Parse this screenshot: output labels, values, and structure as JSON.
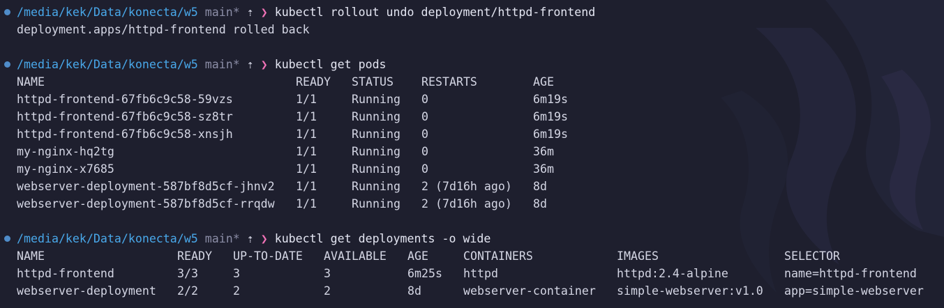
{
  "theme": {
    "background": "#1e1f2e",
    "path_color": "#49a8ea",
    "branch_color": "#8b8da6",
    "prompt_symbol_color": "#f072b6",
    "text_color": "#d4d6e4",
    "bullet_color": "#4f8cc9"
  },
  "prompt": {
    "path": "/media/kek/Data/konecta/w5",
    "branch": "main*",
    "ahead_icon": "⇡",
    "symbol": "❯"
  },
  "blocks": [
    {
      "command": "kubectl rollout undo deployment/httpd-frontend",
      "output": "deployment.apps/httpd-frontend rolled back"
    },
    {
      "command": "kubectl get pods",
      "headers": [
        "NAME",
        "READY",
        "STATUS",
        "RESTARTS",
        "AGE"
      ],
      "rows": [
        [
          "httpd-frontend-67fb6c9c58-59vzs",
          "1/1",
          "Running",
          "0",
          "6m19s"
        ],
        [
          "httpd-frontend-67fb6c9c58-sz8tr",
          "1/1",
          "Running",
          "0",
          "6m19s"
        ],
        [
          "httpd-frontend-67fb6c9c58-xnsjh",
          "1/1",
          "Running",
          "0",
          "6m19s"
        ],
        [
          "my-nginx-hq2tg",
          "1/1",
          "Running",
          "0",
          "36m"
        ],
        [
          "my-nginx-x7685",
          "1/1",
          "Running",
          "0",
          "36m"
        ],
        [
          "webserver-deployment-587bf8d5cf-jhnv2",
          "1/1",
          "Running",
          "2 (7d16h ago)",
          "8d"
        ],
        [
          "webserver-deployment-587bf8d5cf-rrqdw",
          "1/1",
          "Running",
          "2 (7d16h ago)",
          "8d"
        ]
      ]
    },
    {
      "command": "kubectl get deployments -o wide",
      "headers": [
        "NAME",
        "READY",
        "UP-TO-DATE",
        "AVAILABLE",
        "AGE",
        "CONTAINERS",
        "IMAGES",
        "SELECTOR"
      ],
      "rows": [
        [
          "httpd-frontend",
          "3/3",
          "3",
          "3",
          "6m25s",
          "httpd",
          "httpd:2.4-alpine",
          "name=httpd-frontend"
        ],
        [
          "webserver-deployment",
          "2/2",
          "2",
          "2",
          "8d",
          "webserver-container",
          "simple-webserver:v1.0",
          "app=simple-webserver"
        ]
      ]
    }
  ]
}
